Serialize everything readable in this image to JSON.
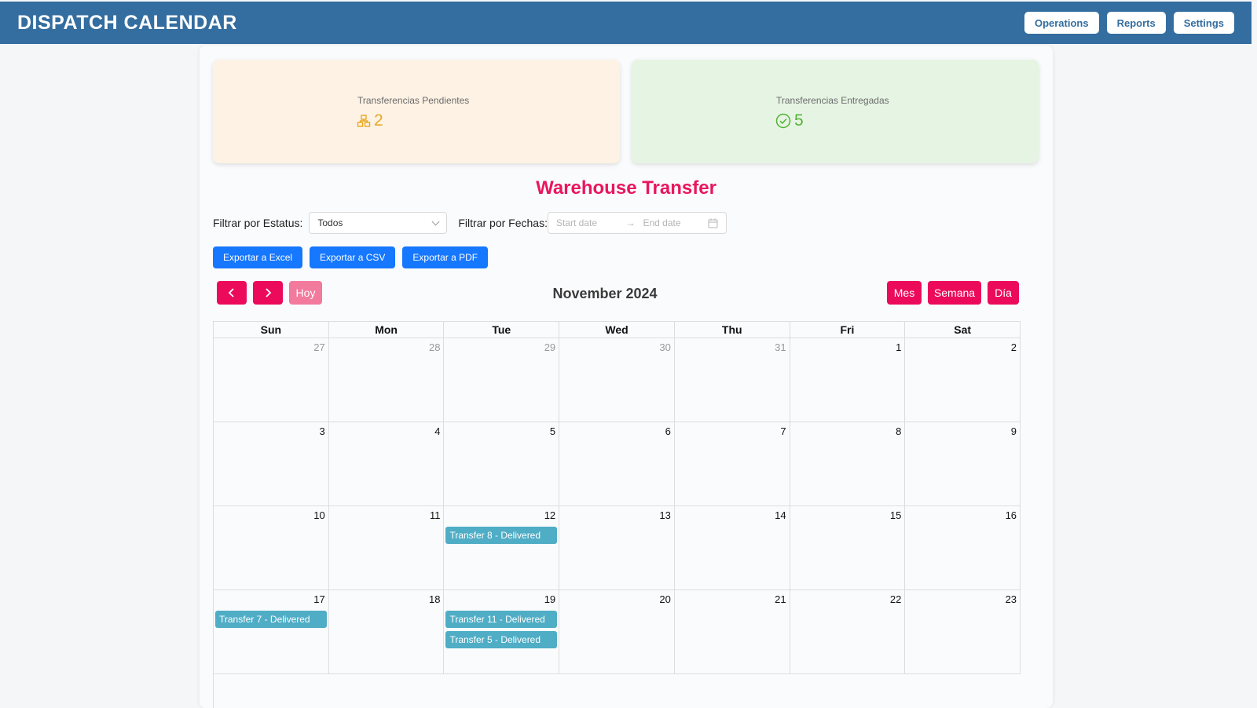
{
  "header": {
    "title": "DISPATCH CALENDAR",
    "nav": [
      "Operations",
      "Reports",
      "Settings"
    ]
  },
  "cards": {
    "pending": {
      "label": "Transferencias Pendientes",
      "value": "2",
      "icon": "boxes-icon",
      "color": "#e8a723"
    },
    "delivered": {
      "label": "Transferencias Entregadas",
      "value": "5",
      "icon": "check-circle-icon",
      "color": "#53b236"
    }
  },
  "page_title": "Warehouse Transfer",
  "filters": {
    "status_label": "Filtrar por Estatus:",
    "status_value": "Todos",
    "date_label": "Filtrar por Fechas:",
    "start_placeholder": "Start date",
    "end_placeholder": "End date"
  },
  "export": [
    "Exportar a Excel",
    "Exportar a CSV",
    "Exportar a PDF"
  ],
  "calendar": {
    "today_label": "Hoy",
    "title": "November 2024",
    "views": [
      "Mes",
      "Semana",
      "Día"
    ],
    "weekdays": [
      "Sun",
      "Mon",
      "Tue",
      "Wed",
      "Thu",
      "Fri",
      "Sat"
    ],
    "weeks": [
      [
        {
          "n": "27",
          "other": true
        },
        {
          "n": "28",
          "other": true
        },
        {
          "n": "29",
          "other": true
        },
        {
          "n": "30",
          "other": true
        },
        {
          "n": "31",
          "other": true
        },
        {
          "n": "1"
        },
        {
          "n": "2"
        }
      ],
      [
        {
          "n": "3"
        },
        {
          "n": "4"
        },
        {
          "n": "5"
        },
        {
          "n": "6"
        },
        {
          "n": "7"
        },
        {
          "n": "8"
        },
        {
          "n": "9"
        }
      ],
      [
        {
          "n": "10"
        },
        {
          "n": "11"
        },
        {
          "n": "12",
          "events": [
            "Transfer 8 - Delivered"
          ]
        },
        {
          "n": "13"
        },
        {
          "n": "14"
        },
        {
          "n": "15"
        },
        {
          "n": "16"
        }
      ],
      [
        {
          "n": "17",
          "events": [
            "Transfer 7 - Delivered"
          ]
        },
        {
          "n": "18"
        },
        {
          "n": "19",
          "events": [
            "Transfer 11 - Delivered",
            "Transfer 5 - Delivered"
          ]
        },
        {
          "n": "20"
        },
        {
          "n": "21"
        },
        {
          "n": "22"
        },
        {
          "n": "23"
        }
      ]
    ],
    "colors": {
      "accent": "#ec0b5b",
      "today": "#f27a9d",
      "event": "#4fadc5"
    }
  },
  "colors": {
    "header": "#346d9f",
    "title": "#e8175d",
    "export": "#1677ff"
  }
}
